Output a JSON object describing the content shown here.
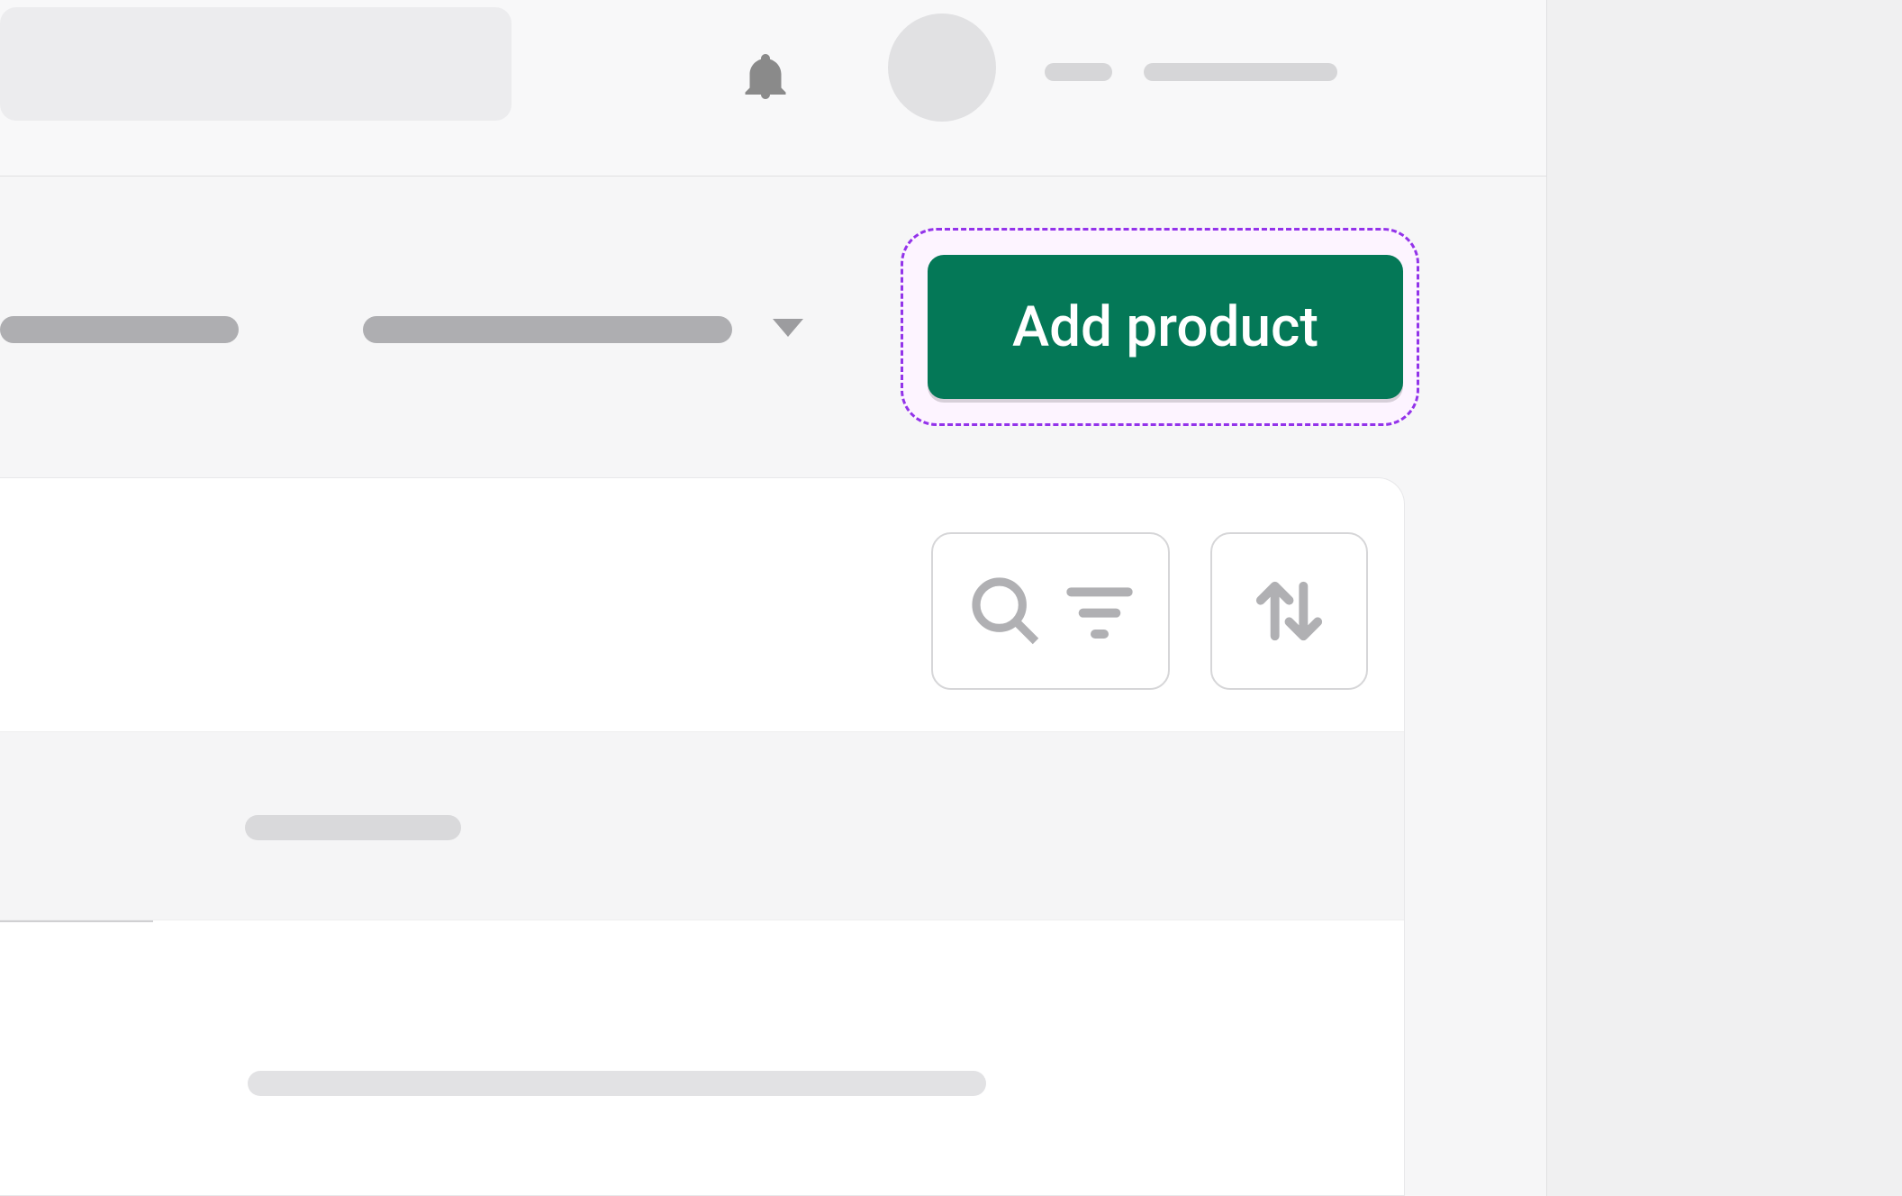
{
  "header": {
    "search_placeholder": "",
    "notification_icon": "bell-icon",
    "avatar_icon": "avatar"
  },
  "toolbar": {
    "dropdown_icon": "chevron-down-icon",
    "add_product_label": "Add product"
  },
  "card": {
    "search_filter_icon": "search-filter-icon",
    "sort_icon": "sort-icon"
  },
  "colors": {
    "primary_green": "#047857",
    "highlight_purple": "#9333ea",
    "highlight_bg": "#fdf4ff"
  }
}
